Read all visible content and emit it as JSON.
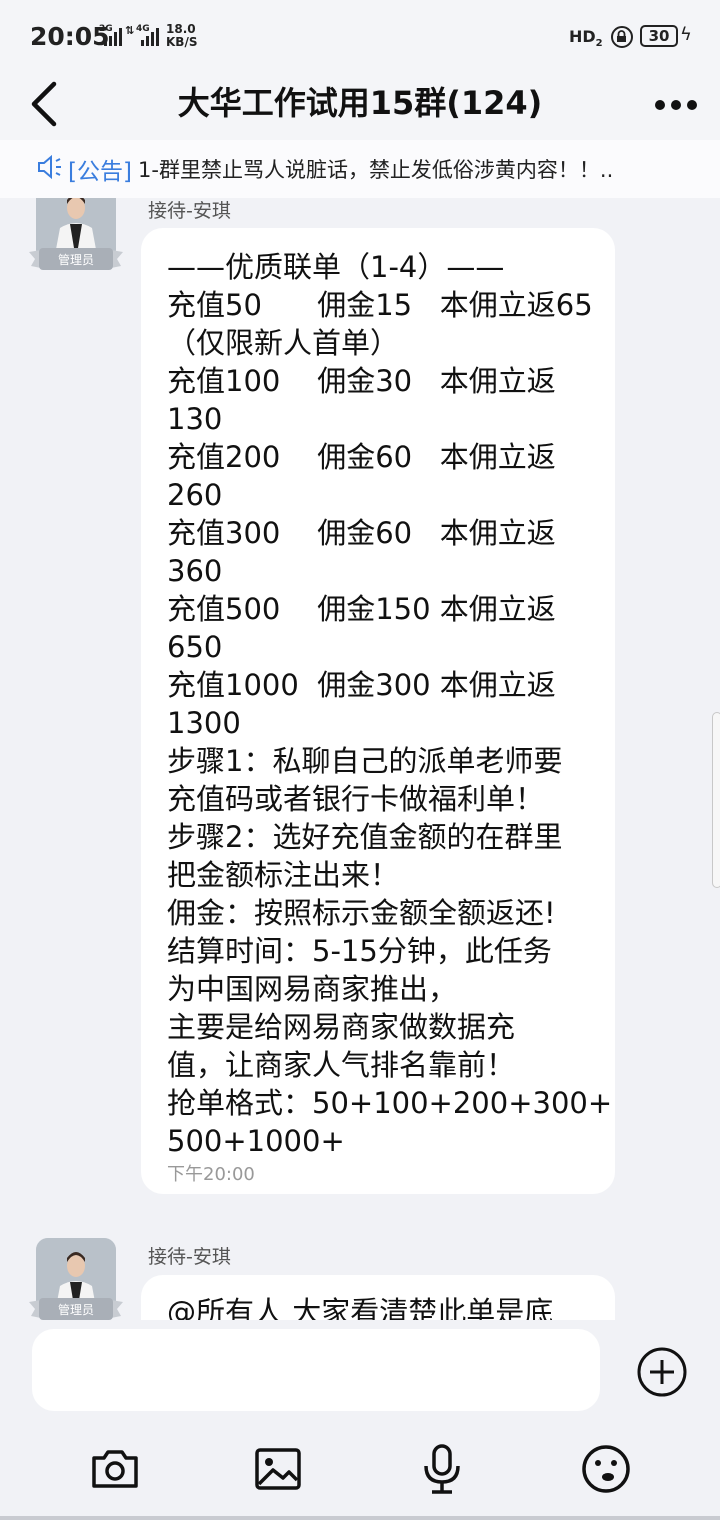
{
  "status_bar": {
    "time": "20:05",
    "signal_1": "2G",
    "signal_2": "4G",
    "net_speed_value": "18.0",
    "net_speed_unit": "KB/S",
    "hd": "HD",
    "hd_sub": "2",
    "battery": "30"
  },
  "header": {
    "title": "大华工作试用15群(124)"
  },
  "notice": {
    "tag": "[公告]",
    "text": "1-群里禁止骂人说脏话，禁止发低俗涉黄内容！！.."
  },
  "messages": [
    {
      "sender": "接待-安琪",
      "badge": "管理员",
      "lines": [
        "——优质联单（1-4）——",
        "充值50      佣金15   本佣立返65",
        "（仅限新人首单）",
        "充值100    佣金30   本佣立返",
        "130",
        "充值200    佣金60   本佣立返",
        "260",
        "充值300    佣金60   本佣立返",
        "360",
        "充值500    佣金150 本佣立返",
        "650",
        "充值1000  佣金300 本佣立返",
        "1300",
        "步骤1：私聊自己的派单老师要",
        "充值码或者银行卡做福利单！",
        "步骤2：选好充值金额的在群里",
        "把金额标注出来！",
        "佣金：按照标示金额全额返还!",
        "结算时间：5-15分钟，此任务",
        "为中国网易商家推出，",
        "主要是给网易商家做数据充",
        "值，让商家人气排名靠前！",
        "抢单格式：50+100+200+300+",
        "500+1000+"
      ],
      "time": "下午20:00"
    },
    {
      "sender": "接待-安琪",
      "badge": "管理员",
      "lines": [
        "@所有人 大家看清楚此单是底"
      ]
    }
  ],
  "input": {
    "placeholder": ""
  },
  "toolbar": [
    "camera-icon",
    "image-icon",
    "microphone-icon",
    "emoji-icon"
  ]
}
